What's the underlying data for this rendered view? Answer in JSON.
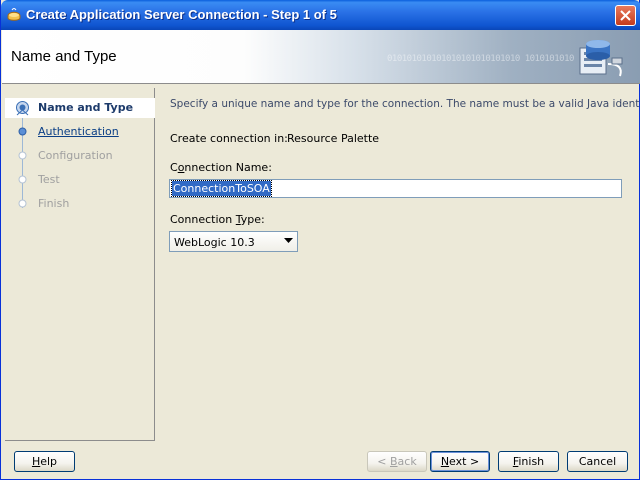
{
  "window": {
    "title": "Create Application Server Connection - Step 1 of 5"
  },
  "banner": {
    "title": "Name and Type",
    "binary_text": "010101010101010101010101010 1010101010"
  },
  "nav": {
    "steps": [
      {
        "label": "Name and Type",
        "state": "current"
      },
      {
        "label": "Authentication",
        "state": "link"
      },
      {
        "label": "Configuration",
        "state": "disabled"
      },
      {
        "label": "Test",
        "state": "disabled"
      },
      {
        "label": "Finish",
        "state": "disabled"
      }
    ]
  },
  "main": {
    "instruction": "Specify a unique name and type for the connection. The name must be a valid Java identifier.",
    "create_in_label": "Create connection in:",
    "create_in_value": "Resource Palette",
    "name_label_pre": "C",
    "name_label_u": "o",
    "name_label_post": "nnection Name:",
    "name_value": "ConnectionToSOA",
    "type_label_pre": "Connection ",
    "type_label_u": "T",
    "type_label_post": "ype:",
    "type_value": "WebLogic 10.3"
  },
  "buttons": {
    "help_u": "H",
    "help_rest": "elp",
    "back_pre": "< ",
    "back_u": "B",
    "back_rest": "ack",
    "next_u": "N",
    "next_rest": "ext >",
    "finish_u": "F",
    "finish_rest": "inish",
    "cancel": "Cancel"
  },
  "colors": {
    "titlebar": "#0a5fdc",
    "selection": "#316ac5",
    "link": "#0b3f86"
  }
}
